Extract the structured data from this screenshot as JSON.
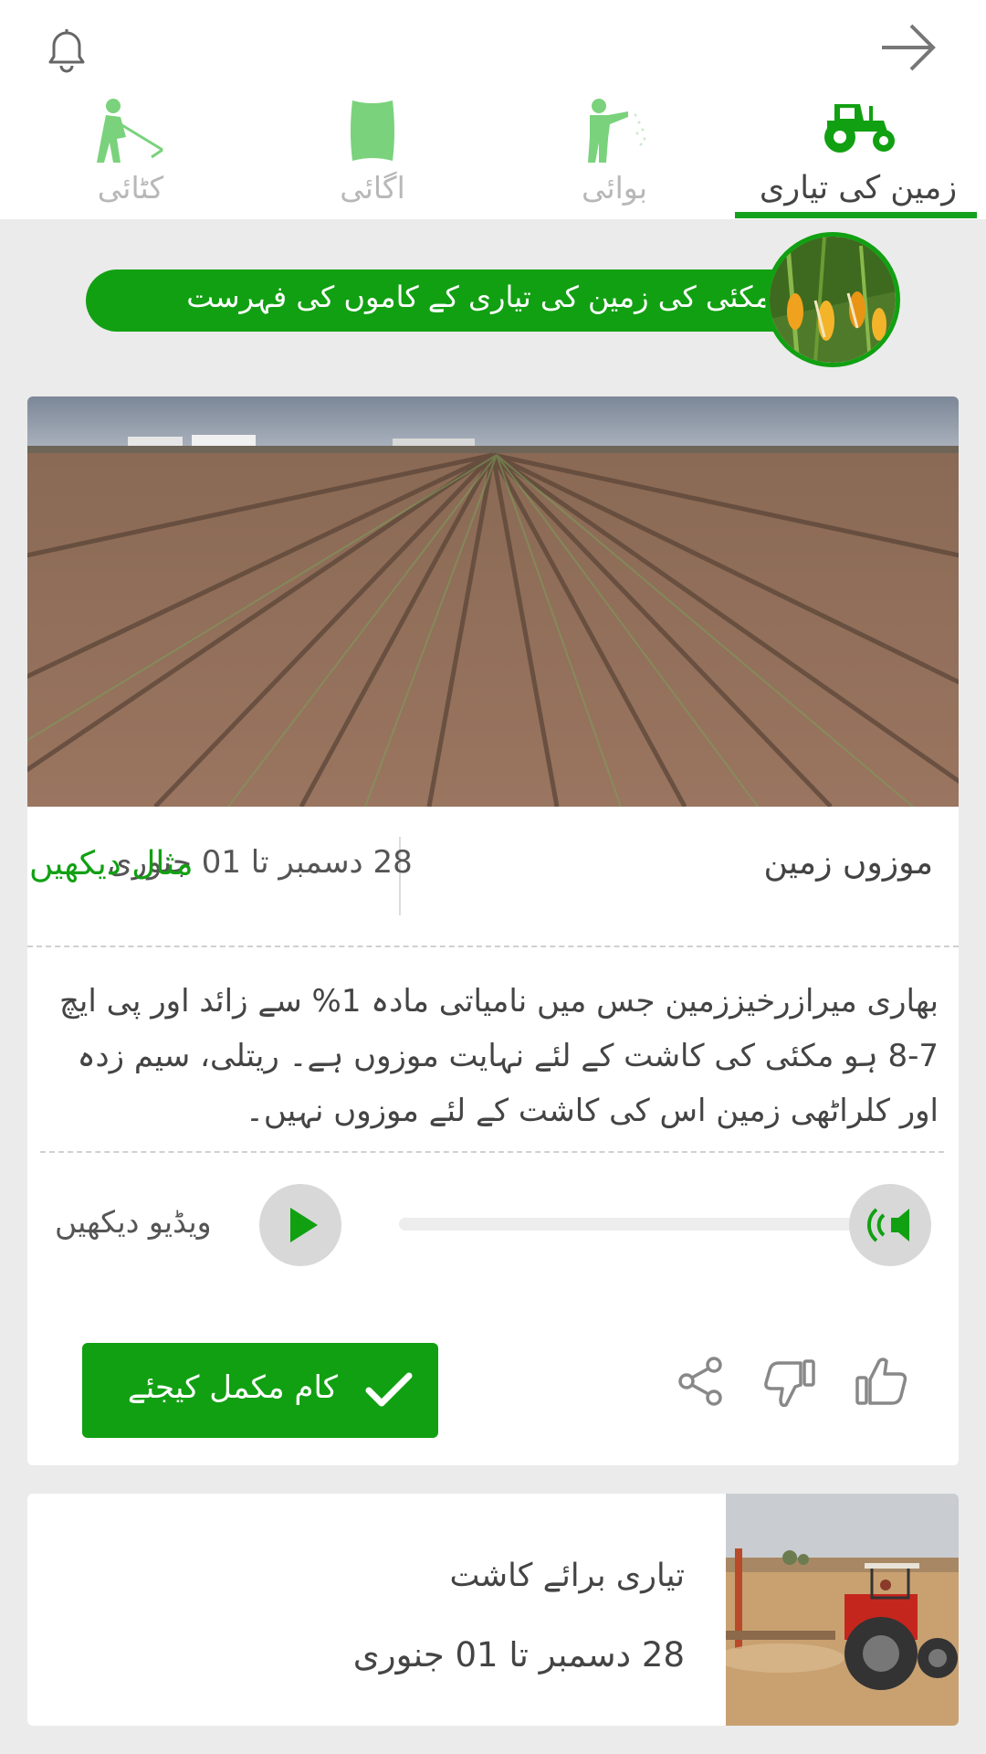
{
  "header": {
    "notification_icon": "bell-icon",
    "forward_icon": "arrow-right-icon"
  },
  "tabs": [
    {
      "label": "کٹائی",
      "icon": "harvesting-person-icon",
      "active": false
    },
    {
      "label": "اگائی",
      "icon": "sack-icon",
      "active": false
    },
    {
      "label": "بوائی",
      "icon": "sowing-person-icon",
      "active": false
    },
    {
      "label": "زمین کی تیاری",
      "icon": "tractor-icon",
      "active": true
    }
  ],
  "banner": {
    "text": "مکئی کی زمین کی تیاری کے کاموں کی فہرست",
    "image": "corn-crop-image"
  },
  "task_card": {
    "image": "plowed-field-image",
    "title": "موزوں زمین",
    "date_range": "28 دسمبر تا 01 جنوری",
    "example_link": "مثال دیکھیں",
    "description": "بھاری میرازرخیززمین جس میں نامیاتی مادہ 1% سے زائد اور پی ایچ 7-8 ہو مکئی کی کاشت کے لئے نہایت موزوں ہے۔ ریتلی، سیم زدہ اور کلراٹھی زمین اس کی کاشت کے لئے موزوں نہیں۔",
    "video_label": "ویڈیو دیکھیں",
    "audio_progress": 0.0,
    "complete_button": "کام مکمل کیجئے"
  },
  "next_card": {
    "image": "tractor-field-image",
    "title": "تیاری برائے کاشت",
    "date_range": "28 دسمبر تا 01 جنوری"
  },
  "colors": {
    "accent": "#11a012",
    "background": "#ebebeb",
    "inactive_tab": "#b8b8b8"
  }
}
